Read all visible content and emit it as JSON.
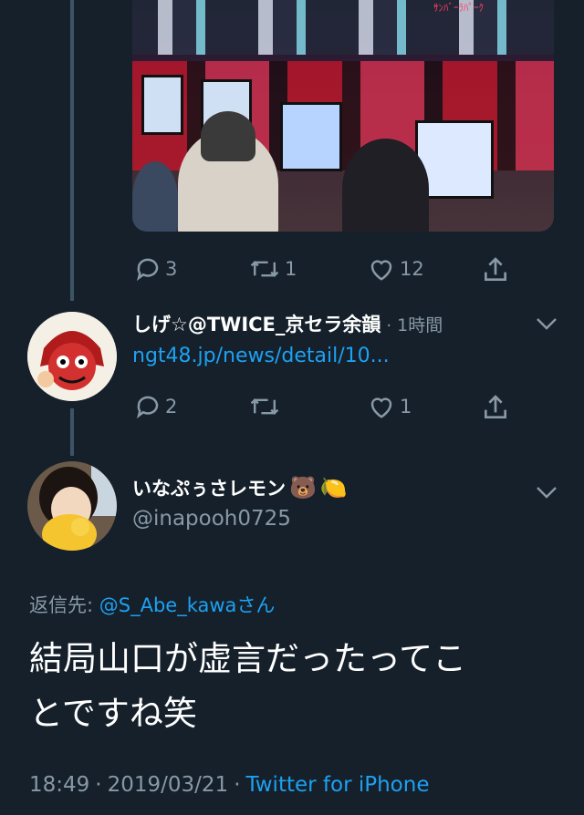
{
  "tweet1": {
    "actions": {
      "reply_count": "3",
      "retweet_count": "1",
      "like_count": "12"
    }
  },
  "reply1": {
    "user_name": "しげ☆@TWICE_京セラ余韻",
    "separator": "·",
    "time": "1時間",
    "link_text": "ngt48.jp/news/detail/10...",
    "actions": {
      "reply_count": "2",
      "retweet_count": "",
      "like_count": "1"
    }
  },
  "main_tweet": {
    "user_name": "いなぷぅさレモン",
    "user_emoji_1": "🐻",
    "user_emoji_2": "🍋",
    "handle": "@inapooh0725",
    "reply_to_label": "返信先: ",
    "reply_to_handle": "@S_Abe_kawa",
    "reply_to_suffix": "さん",
    "text_line1": "結局山口が虚言だったってこ",
    "text_line2": "とですね笑",
    "time": "18:49",
    "separator1": "·",
    "date": "2019/03/21",
    "separator2": "·",
    "source": "Twitter for iPhone"
  },
  "colors": {
    "background": "#15202b",
    "secondary_text": "#8899a6",
    "link": "#1da1f2",
    "thread_line": "#3d5466"
  },
  "icons": [
    "reply-icon",
    "retweet-icon",
    "like-icon",
    "share-icon",
    "chevron-down-icon"
  ]
}
